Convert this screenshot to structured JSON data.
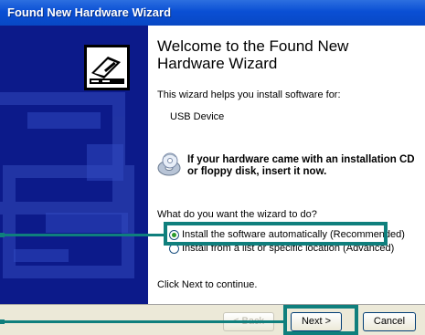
{
  "window": {
    "title": "Found New Hardware Wizard"
  },
  "content": {
    "heading": "Welcome to the Found New Hardware Wizard",
    "intro": "This wizard helps you install software for:",
    "device": "USB Device",
    "cd_note": "If your hardware came with an installation CD or floppy disk, insert it now.",
    "question": "What do you want the wizard to do?",
    "options": [
      {
        "label": "Install the software automatically (Recommended)",
        "selected": true
      },
      {
        "label": "Install from a list or specific location (Advanced)",
        "selected": false
      }
    ],
    "continue_hint": "Click Next to continue."
  },
  "buttons": {
    "back": "< Back",
    "next": "Next >",
    "cancel": "Cancel"
  },
  "colors": {
    "titlebar": "#0a4fd4",
    "left_panel": "#0c1a8a",
    "highlight": "#0f7f7d",
    "button_bar": "#ece9d8"
  },
  "icons": [
    "hardware-wizard-icon",
    "cd-disk-icon"
  ]
}
